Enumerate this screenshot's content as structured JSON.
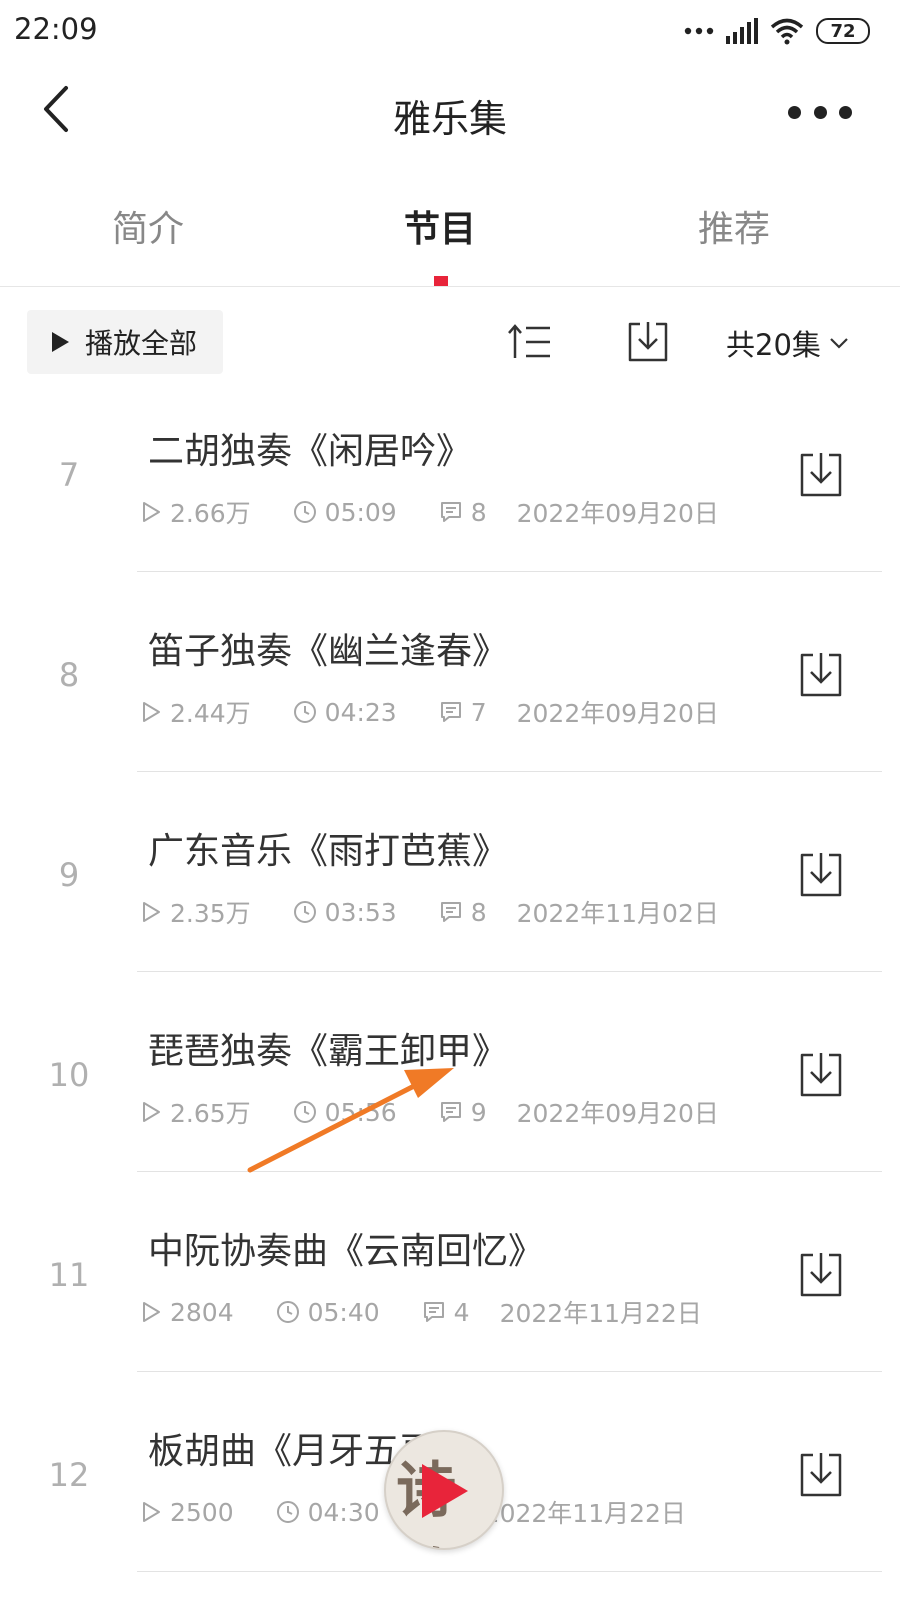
{
  "status_bar": {
    "time": "22:09",
    "battery": "72"
  },
  "header": {
    "title": "雅乐集"
  },
  "tabs": [
    {
      "label": "简介",
      "active": false
    },
    {
      "label": "节目",
      "active": true
    },
    {
      "label": "推荐",
      "active": false
    }
  ],
  "toolbar": {
    "play_all_label": "播放全部",
    "episode_count": "共20集"
  },
  "episodes": [
    {
      "num": "7",
      "title": "二胡独奏《闲居吟》",
      "plays": "2.66万",
      "duration": "05:09",
      "comments": "8",
      "date": "2022年09月20日"
    },
    {
      "num": "8",
      "title": "笛子独奏《幽兰逢春》",
      "plays": "2.44万",
      "duration": "04:23",
      "comments": "7",
      "date": "2022年09月20日"
    },
    {
      "num": "9",
      "title": "广东音乐《雨打芭蕉》",
      "plays": "2.35万",
      "duration": "03:53",
      "comments": "8",
      "date": "2022年11月02日"
    },
    {
      "num": "10",
      "title": "琵琶独奏《霸王卸甲》",
      "plays": "2.65万",
      "duration": "05:56",
      "comments": "9",
      "date": "2022年09月20日"
    },
    {
      "num": "11",
      "title": "中阮协奏曲《云南回忆》",
      "plays": "2804",
      "duration": "05:40",
      "comments": "4",
      "date": "2022年11月22日"
    },
    {
      "num": "12",
      "title": "板胡曲《月牙五更》",
      "plays": "2500",
      "duration": "04:30",
      "comments": "",
      "date": "2022年11月22日"
    }
  ],
  "mini_player": {
    "cover_text": "诗歌"
  },
  "colors": {
    "accent": "#e8243a",
    "annotation_arrow": "#f07a26"
  }
}
